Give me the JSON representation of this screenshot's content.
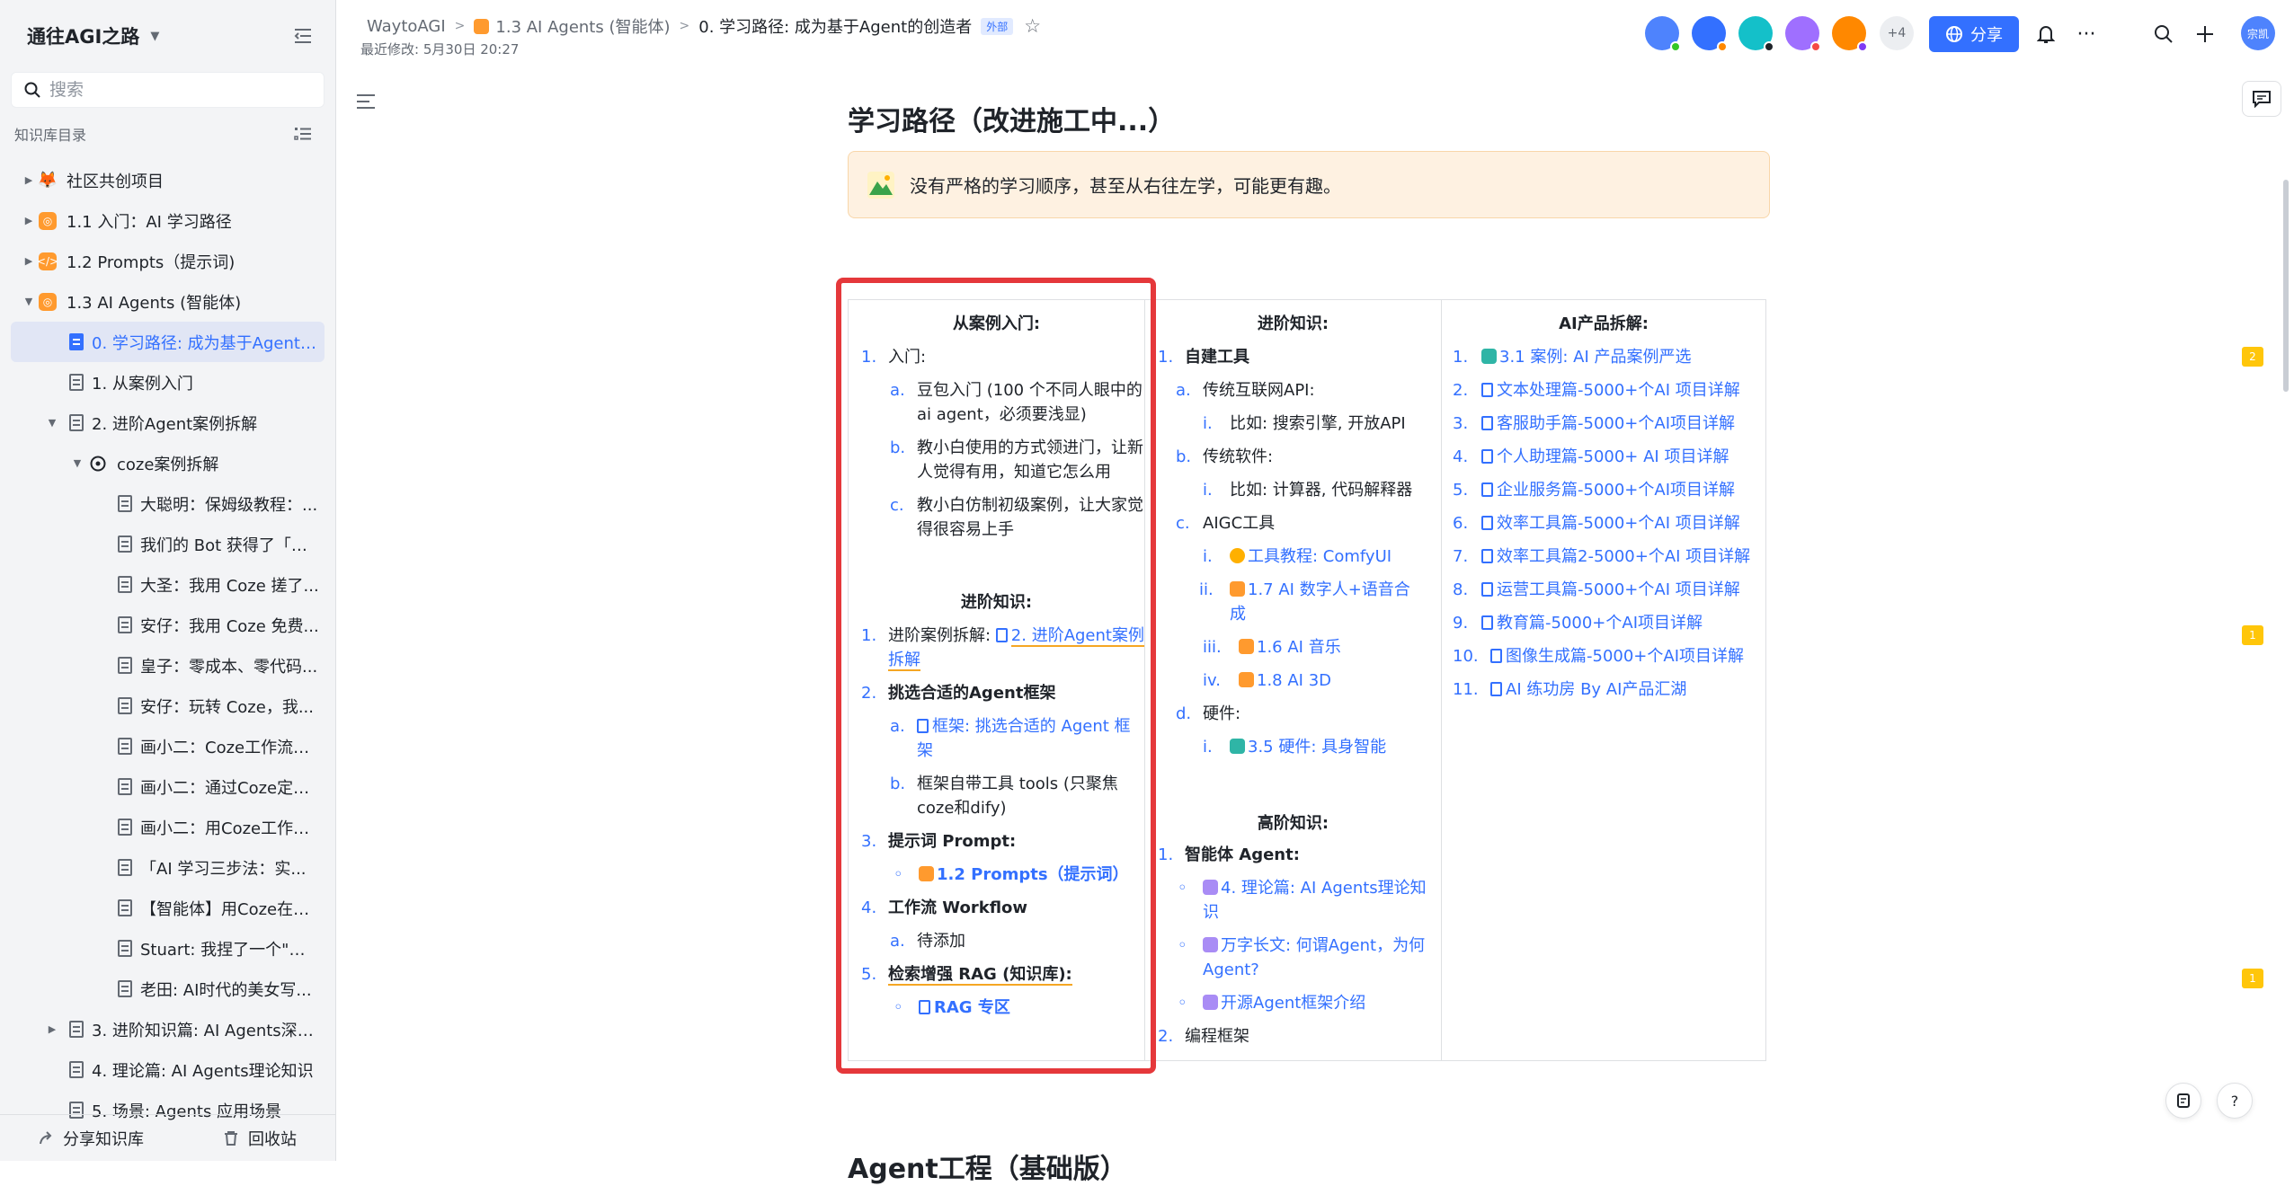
{
  "sidebar": {
    "workspace_title": "通往AGI之路",
    "search_placeholder": "搜索",
    "tree_header": "知识库目录",
    "items": [
      {
        "label": "社区共创项目"
      },
      {
        "label": "1.1 入门：AI 学习路径"
      },
      {
        "label": "1.2 Prompts（提示词)"
      },
      {
        "label": "1.3 AI Agents (智能体)"
      },
      {
        "label": "0. 学习路径: 成为基于Agent的..."
      },
      {
        "label": "1. 从案例入门"
      },
      {
        "label": "2. 进阶Agent案例拆解"
      },
      {
        "label": "coze案例拆解"
      },
      {
        "label": "大聪明：保姆级教程：..."
      },
      {
        "label": "我们的 Bot 获得了「掘..."
      },
      {
        "label": "大圣：我用 Coze 搓了..."
      },
      {
        "label": "安仔：我用 Coze 免费..."
      },
      {
        "label": "皇子：零成本、零代码..."
      },
      {
        "label": "安仔：玩转 Coze，我..."
      },
      {
        "label": "画小二：Coze工作流之..."
      },
      {
        "label": "画小二：通过Coze定制..."
      },
      {
        "label": "画小二：用Coze工作流..."
      },
      {
        "label": "「AI 学习三步法：实..."
      },
      {
        "label": "【智能体】用Coze在微..."
      },
      {
        "label": "Stuart: 我捏了一个\"剧..."
      },
      {
        "label": "老田: AI时代的美女写..."
      },
      {
        "label": "3. 进阶知识篇: AI Agents深入..."
      },
      {
        "label": "4. 理论篇: AI Agents理论知识"
      },
      {
        "label": "5. 场景: Agents 应用场景"
      }
    ],
    "share_label": "分享知识库",
    "recycle_label": "回收站"
  },
  "topbar": {
    "crumb1": "WaytoAGI",
    "crumb2": "1.3  AI Agents (智能体)",
    "crumb3": "0. 学习路径: 成为基于Agent的创造者",
    "external_badge": "外部",
    "last_modified": "最近修改: 5月30日 20:27",
    "more_count": "+4",
    "share_button": "分享",
    "me_avatar": "宗凯"
  },
  "doc": {
    "title": "学习路径（改进施工中...）",
    "callout": "没有严格的学习顺序，甚至从右往左学，可能更有趣。",
    "next_heading": "Agent工程（基础版）"
  },
  "table": {
    "col1": {
      "header": "从案例入门:",
      "l1_num": "1.",
      "l1": "入门:",
      "a_num": "a.",
      "a1": "豆包入门 (100 个不同人眼中的",
      "a2": "ai agent，必须要浅显)",
      "b_num": "b.",
      "b1": "教小白使用的方式领进门，让新",
      "b2": "人觉得有用，知道它怎么用",
      "c_num": "c.",
      "c1": "教小白仿制初级案例，让大家觉",
      "c2": "得很容易上手",
      "header2": "进阶知识:",
      "m1_num": "1.",
      "m1_pre": "进阶案例拆解: ",
      "m1_link1": "2. 进阶Agent案例",
      "m1_link2": "拆解",
      "m2_num": "2.",
      "m2": "挑选合适的Agent框架",
      "m2a_num": "a.",
      "m2a1": "框架: 挑选合适的 Agent 框",
      "m2a2": "架",
      "m2b_num": "b.",
      "m2b1": "框架自带工具 tools (只聚焦",
      "m2b2": "coze和dify)",
      "m3_num": "3.",
      "m3": "提示词 Prompt:",
      "m3a": "1.2 Prompts（提示词）",
      "m4_num": "4.",
      "m4": "工作流 Workflow",
      "m4a_num": "a.",
      "m4a": "待添加",
      "m5_num": "5.",
      "m5": "检索增强 RAG (知识库):",
      "m5a": "RAG 专区"
    },
    "col2": {
      "header": "进阶知识:",
      "l1_num": "1.",
      "l1": "自建工具",
      "a_num": "a.",
      "a": "传统互联网API:",
      "ai_num": "i.",
      "ai": "比如: 搜索引擎, 开放API",
      "b_num": "b.",
      "b": "传统软件:",
      "bi_num": "i.",
      "bi": "比如: 计算器, 代码解释器",
      "c_num": "c.",
      "c": "AIGC工具",
      "ci_num": "i.",
      "ci": "工具教程: ComfyUI",
      "cii_num": "ii.",
      "cii1": "1.7 AI 数字人+语音合",
      "cii2": "成",
      "ciii_num": "iii.",
      "ciii": "1.6 AI 音乐",
      "civ_num": "iv.",
      "civ": "1.8 AI 3D",
      "d_num": "d.",
      "d": "硬件:",
      "di_num": "i.",
      "di": "3.5 硬件: 具身智能",
      "header2": "高阶知识:",
      "h1_num": "1.",
      "h1": "智能体 Agent:",
      "h1a1": "4. 理论篇: AI Agents理论知",
      "h1a2": "识",
      "h1b1": "万字长文: 何谓Agent，为何",
      "h1b2": "Agent?",
      "h1c": "开源Agent框架介绍",
      "h2_num": "2.",
      "h2": "编程框架"
    },
    "col3": {
      "header": "AI产品拆解:",
      "items": [
        {
          "num": "1.",
          "label": "3.1 案例: AI 产品案例严选"
        },
        {
          "num": "2.",
          "label": "文本处理篇-5000+个AI 项目详解"
        },
        {
          "num": "3.",
          "label": "客服助手篇-5000+个AI项目详解"
        },
        {
          "num": "4.",
          "label": "个人助理篇-5000+ AI 项目详解"
        },
        {
          "num": "5.",
          "label": "企业服务篇-5000+个AI项目详解"
        },
        {
          "num": "6.",
          "label": "效率工具篇-5000+个AI 项目详解"
        },
        {
          "num": "7.",
          "label": "效率工具篇2-5000+个AI 项目详解"
        },
        {
          "num": "8.",
          "label": "运营工具篇-5000+个AI 项目详解"
        },
        {
          "num": "9.",
          "label": "教育篇-5000+个AI项目详解"
        },
        {
          "num": "10.",
          "label": "图像生成篇-5000+个AI项目详解"
        },
        {
          "num": "11.",
          "label": "AI 练功房 By AI产品汇湖"
        }
      ]
    }
  },
  "comments": {
    "badge1": "2",
    "badge2": "1",
    "badge3": "1"
  },
  "colors": {
    "accent": "#3370ff",
    "highlight": "#e5383b",
    "callout_bg": "#fef1e1",
    "badge": "#ffc60a"
  }
}
